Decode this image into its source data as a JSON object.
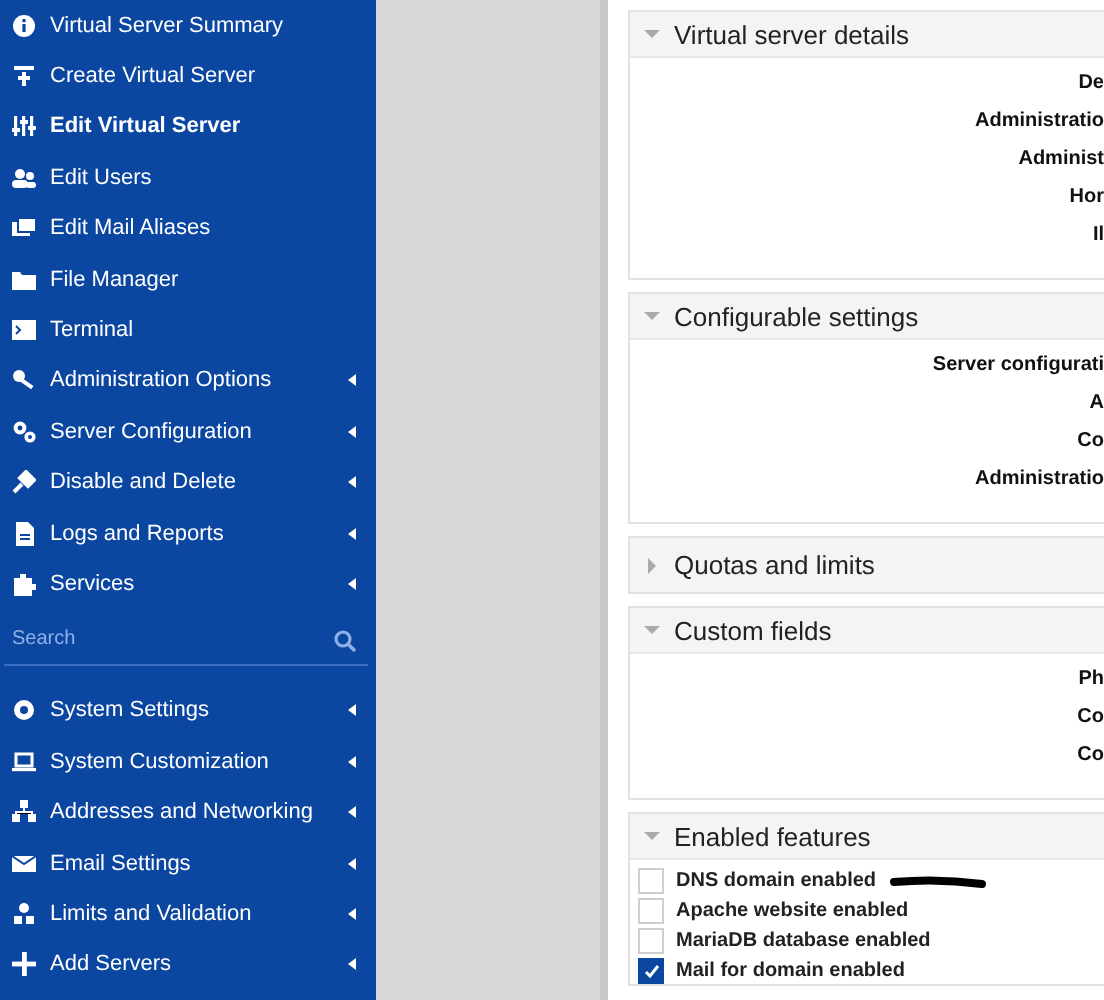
{
  "sidebar": {
    "menu": [
      {
        "label": "Virtual Server Summary",
        "selected": false,
        "submenu": false
      },
      {
        "label": "Create Virtual Server",
        "selected": false,
        "submenu": false
      },
      {
        "label": "Edit Virtual Server",
        "selected": true,
        "submenu": false
      },
      {
        "label": "Edit Users",
        "selected": false,
        "submenu": false
      },
      {
        "label": "Edit Mail Aliases",
        "selected": false,
        "submenu": false
      },
      {
        "label": "File Manager",
        "selected": false,
        "submenu": false
      },
      {
        "label": "Terminal",
        "selected": false,
        "submenu": false
      },
      {
        "label": "Administration Options",
        "selected": false,
        "submenu": true
      },
      {
        "label": "Server Configuration",
        "selected": false,
        "submenu": true
      },
      {
        "label": "Disable and Delete",
        "selected": false,
        "submenu": true
      },
      {
        "label": "Logs and Reports",
        "selected": false,
        "submenu": true
      },
      {
        "label": "Services",
        "selected": false,
        "submenu": true
      }
    ],
    "search": {
      "placeholder": "Search"
    },
    "system_menu": [
      {
        "label": "System Settings",
        "selected": false,
        "submenu": true
      },
      {
        "label": "System Customization",
        "selected": false,
        "submenu": true
      },
      {
        "label": "Addresses and Networking",
        "selected": false,
        "submenu": true
      },
      {
        "label": "Email Settings",
        "selected": false,
        "submenu": true
      },
      {
        "label": "Limits and Validation",
        "selected": false,
        "submenu": true
      },
      {
        "label": "Add Servers",
        "selected": false,
        "submenu": true
      }
    ]
  },
  "panels": [
    {
      "title": "Virtual server details",
      "expanded": true,
      "kind": "fields",
      "labels": [
        "De",
        "Administratio",
        "Administ",
        "Hor",
        "Il"
      ]
    },
    {
      "title": "Configurable settings",
      "expanded": true,
      "kind": "fields",
      "labels": [
        "Server configurati",
        "A",
        "Co",
        "Administratio"
      ]
    },
    {
      "title": "Quotas and limits",
      "expanded": false
    },
    {
      "title": "Custom fields",
      "expanded": true,
      "kind": "fields",
      "labels": [
        "Ph",
        "Co",
        "Co"
      ]
    },
    {
      "title": "Enabled features",
      "expanded": true,
      "kind": "checklist",
      "items": [
        {
          "label": "DNS domain enabled",
          "checked": false,
          "redacted": true
        },
        {
          "label": "Apache website enabled",
          "checked": false,
          "redacted": false
        },
        {
          "label": "MariaDB database enabled",
          "checked": false,
          "redacted": false
        },
        {
          "label": "Mail for domain enabled",
          "checked": true,
          "redacted": false
        }
      ]
    }
  ]
}
